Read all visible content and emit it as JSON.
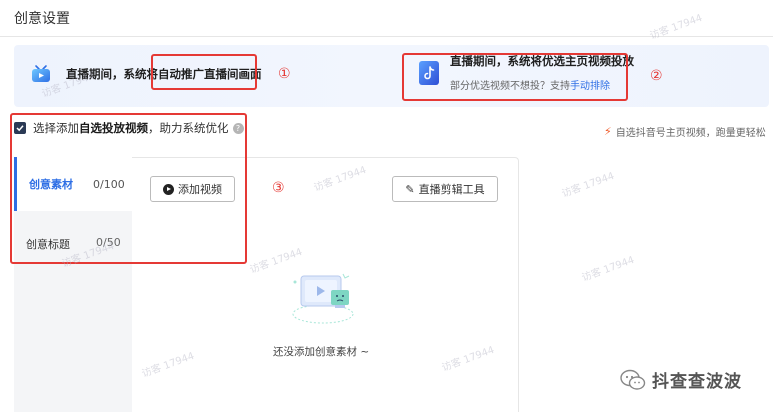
{
  "page": {
    "title": "创意设置"
  },
  "banner": {
    "left_text": "直播期间，系统将自动推广直播间画面",
    "right_text": "直播期间，系统将优选主页视频投放",
    "right_sub_prefix": "部分优选视频不想投？支持",
    "right_sub_link": "手动排除"
  },
  "annotations": {
    "one": "①",
    "two": "②",
    "three": "③"
  },
  "checkbox": {
    "label_prefix": "选择添加",
    "label_bold": "自选投放视频",
    "label_suffix": "，助力系统优化",
    "help": "?",
    "checked": true
  },
  "auto_select": {
    "text": "自选抖音号主页视频，跑量更轻松"
  },
  "side_nav": {
    "items": [
      {
        "label": "创意素材",
        "count": "0/100",
        "active": true
      },
      {
        "label": "创意标题",
        "count": "0/50",
        "active": false
      }
    ]
  },
  "toolbar": {
    "add_video": "添加视频",
    "live_edit_tool": "直播剪辑工具"
  },
  "empty_state": {
    "text": "还没添加创意素材 ~"
  },
  "watermark": {
    "text": "访客 17944"
  },
  "brand": {
    "text": "抖查查波波"
  },
  "colors": {
    "accent": "#2f6fe5",
    "annotation": "#e53935",
    "nav_bg": "#f4f5f7",
    "banner_bg": "#eef3fd"
  }
}
